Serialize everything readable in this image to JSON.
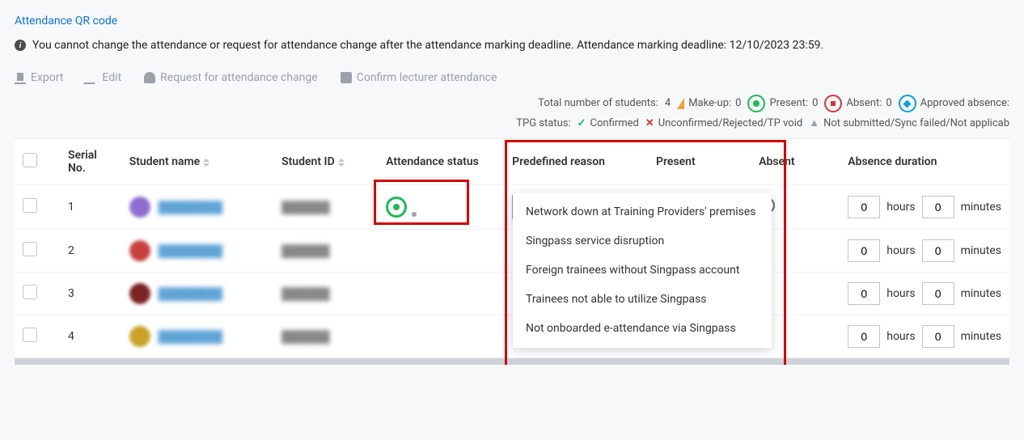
{
  "qr_link": "Attendance QR code",
  "deadline_notice": "You cannot change the attendance or request for attendance change after the attendance marking deadline. Attendance marking deadline: 12/10/2023 23:59.",
  "toolbar": {
    "export": "Export",
    "edit": "Edit",
    "request": "Request for attendance change",
    "confirm": "Confirm lecturer attendance"
  },
  "summary": {
    "total_label": "Total number of students:",
    "total_value": "4",
    "makeup_label": "Make-up:",
    "makeup_value": "0",
    "present_label": "Present:",
    "present_value": "0",
    "absent_label": "Absent:",
    "absent_value": "0",
    "approved_label": "Approved absence:",
    "tpg_label": "TPG status:",
    "tpg_confirmed": "Confirmed",
    "tpg_unconfirmed": "Unconfirmed/Rejected/TP void",
    "tpg_notsubmitted": "Not submitted/Sync failed/Not applicab"
  },
  "table": {
    "headers": {
      "serial": "Serial No.",
      "name": "Student name",
      "id": "Student ID",
      "status": "Attendance status",
      "reason": "Predefined reason",
      "present": "Present",
      "absent": "Absent",
      "duration": "Absence duration"
    },
    "rows": [
      {
        "serial": "1",
        "name_obscured": "████████",
        "id_obscured": "██████",
        "avatar": "av-purple",
        "reason_selected": "None",
        "present_checked": true,
        "hours": "0",
        "minutes": "0"
      },
      {
        "serial": "2",
        "name_obscured": "████████",
        "id_obscured": "██████",
        "avatar": "av-red",
        "hours": "0",
        "minutes": "0"
      },
      {
        "serial": "3",
        "name_obscured": "████████",
        "id_obscured": "██████",
        "avatar": "av-maroon",
        "hours": "0",
        "minutes": "0"
      },
      {
        "serial": "4",
        "name_obscured": "████████",
        "id_obscured": "██████",
        "avatar": "av-gold",
        "hours": "0",
        "minutes": "0"
      }
    ],
    "duration_labels": {
      "hours": "hours",
      "minutes": "minutes"
    }
  },
  "dropdown_options": [
    "Network down at Training Providers' premises",
    "Singpass service disruption",
    "Foreign trainees without Singpass account",
    "Trainees not able to utilize Singpass",
    "Not onboarded e-attendance via Singpass"
  ]
}
